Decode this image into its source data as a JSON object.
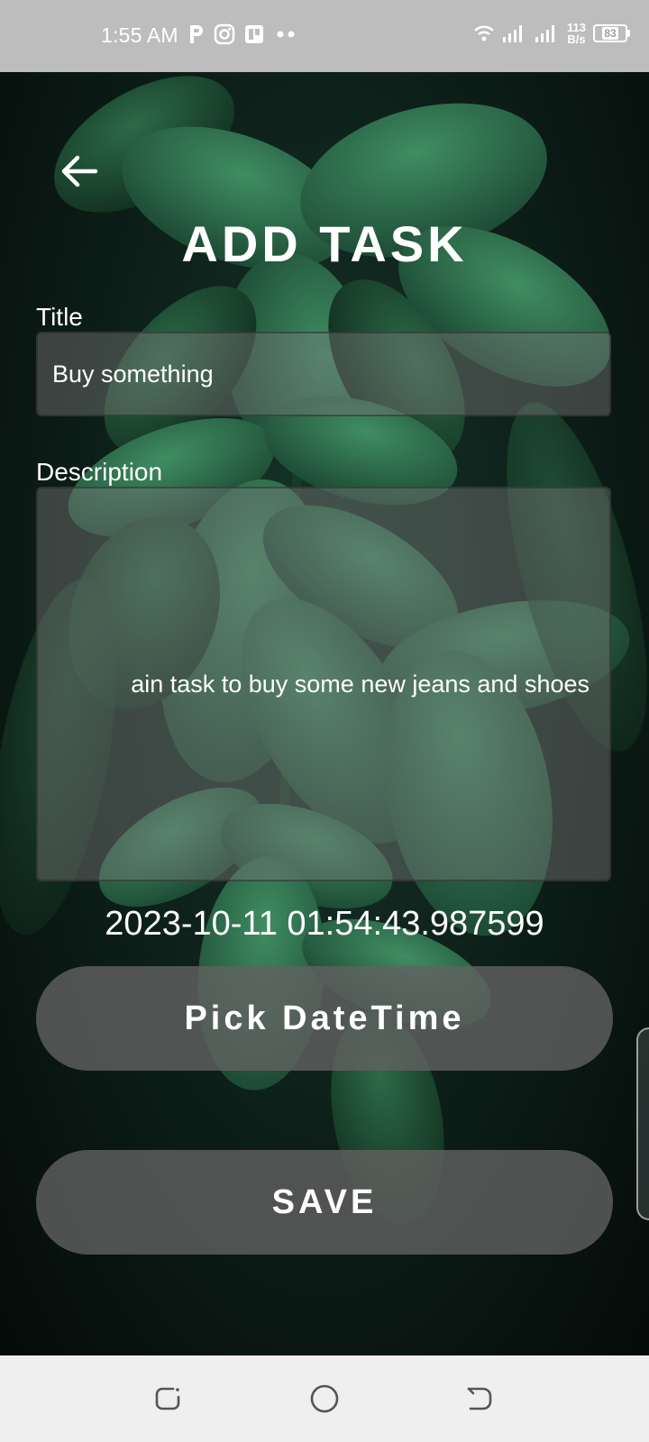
{
  "status_bar": {
    "time": "1:55 AM",
    "speed_value": "113",
    "speed_unit": "B/s",
    "battery": "83",
    "left_icons": [
      "p-icon",
      "instagram-icon",
      "app-icon",
      "more-dots-icon"
    ],
    "right_icons": [
      "wifi-icon",
      "signal-icon",
      "signal-icon-2"
    ]
  },
  "header": {
    "back_icon": "arrow-left-icon",
    "title": "ADD TASK"
  },
  "form": {
    "title_label": "Title",
    "title_value": "Buy something",
    "description_label": "Description",
    "description_value": "ain task to buy some new jeans and shoes",
    "datetime_value": "2023-10-11 01:54:43.987599",
    "pick_button_label": "Pick DateTime",
    "save_button_label": "SAVE"
  },
  "nav_bar": {
    "icons": [
      "recent-apps-icon",
      "home-icon",
      "back-icon"
    ]
  },
  "colors": {
    "status_bar": "#bdbdbd",
    "button_bg": "#626262",
    "nav_bar": "#efefef",
    "text": "#ffffff"
  }
}
